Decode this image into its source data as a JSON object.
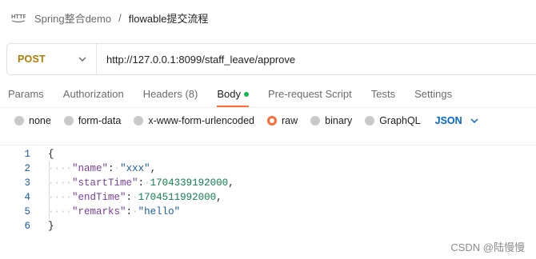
{
  "breadcrumb": {
    "parent": "Spring整合demo",
    "separator": "/",
    "current": "flowable提交流程"
  },
  "request": {
    "method": "POST",
    "url": "http://127.0.0.1:8099/staff_leave/approve"
  },
  "tabs": [
    {
      "label": "Params"
    },
    {
      "label": "Authorization"
    },
    {
      "label": "Headers",
      "count": "(8)"
    },
    {
      "label": "Body",
      "active": true
    },
    {
      "label": "Pre-request Script"
    },
    {
      "label": "Tests"
    },
    {
      "label": "Settings"
    }
  ],
  "body_types": [
    {
      "label": "none"
    },
    {
      "label": "form-data"
    },
    {
      "label": "x-www-form-urlencoded"
    },
    {
      "label": "raw",
      "selected": true
    },
    {
      "label": "binary"
    },
    {
      "label": "GraphQL"
    }
  ],
  "format": "JSON",
  "editor": {
    "line_numbers": [
      "1",
      "2",
      "3",
      "4",
      "5",
      "6"
    ],
    "open_brace": "{",
    "close_brace": "}",
    "fields": [
      {
        "key": "\"name\"",
        "value": "\"xxx\"",
        "suffix": ","
      },
      {
        "key": "\"startTime\"",
        "value": "1704339192000",
        "suffix": ","
      },
      {
        "key": "\"endTime\"",
        "value": "1704511992000",
        "suffix": ","
      },
      {
        "key": "\"remarks\"",
        "value": "\"hello\"",
        "suffix": ""
      }
    ]
  },
  "watermark": "CSDN @陆慢慢",
  "colors": {
    "accent": "#ff6c37",
    "method": "#b07c00",
    "json": "#0265d2",
    "active_dot": "#0cbb52"
  },
  "icons": {
    "http": "http-icon",
    "method_dropdown": "chevron-down-icon",
    "format_dropdown": "chevron-down-icon"
  }
}
